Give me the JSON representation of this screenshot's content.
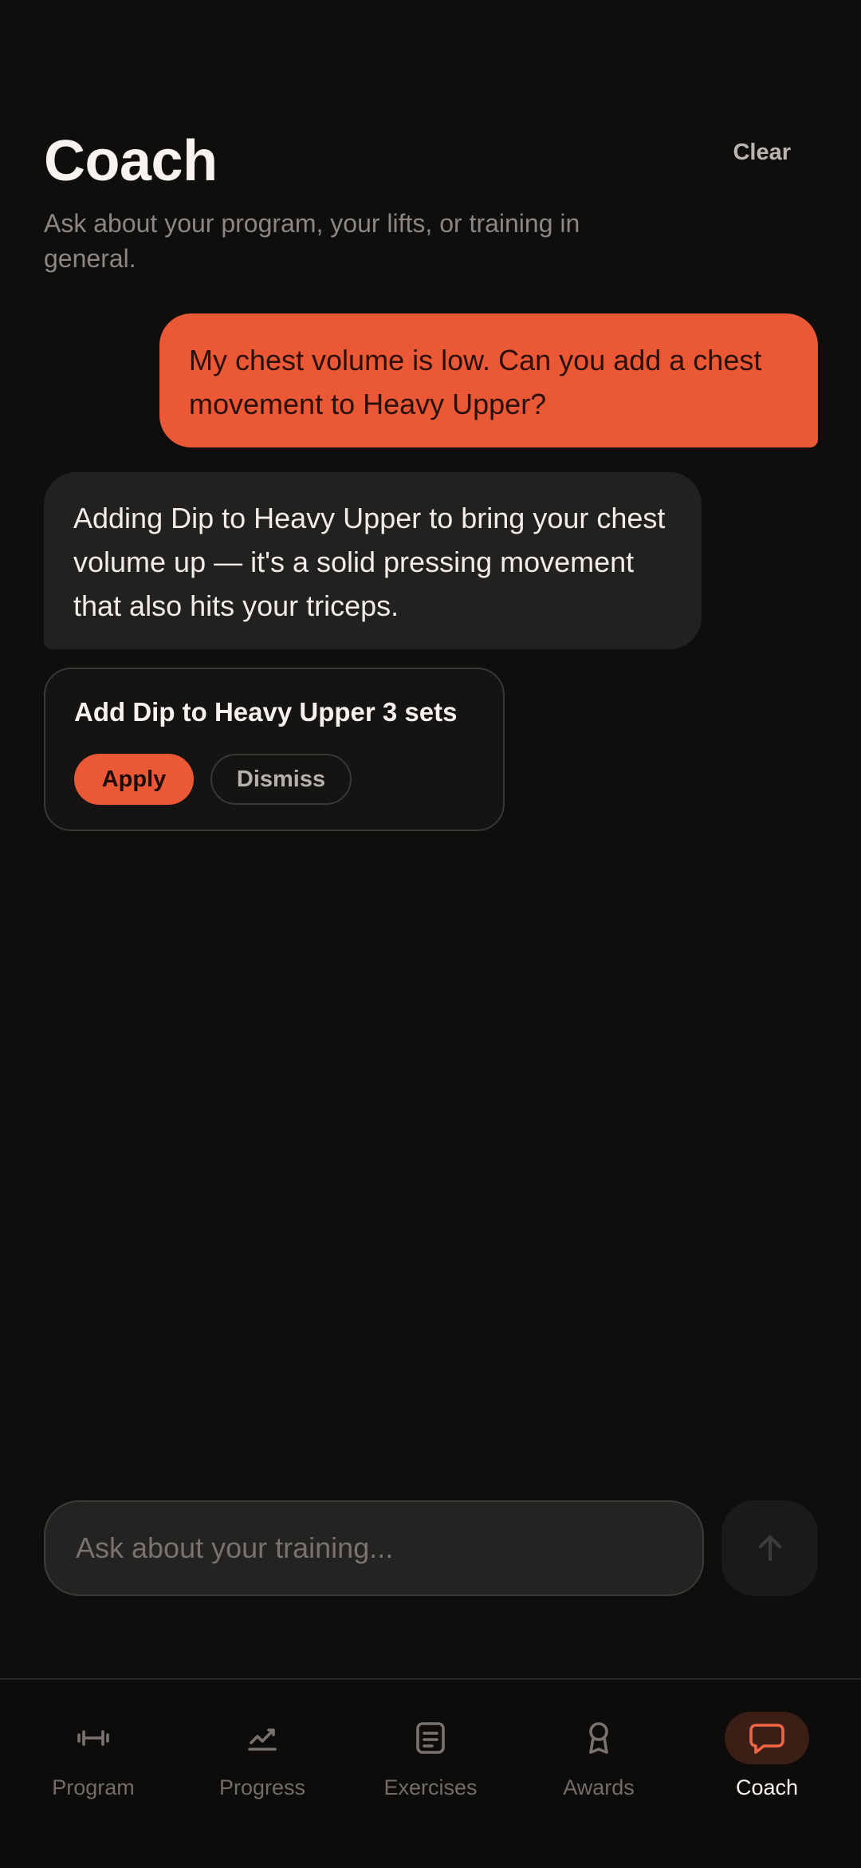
{
  "header": {
    "title": "Coach",
    "subtitle": "Ask about your program, your lifts, or training in general.",
    "clear_label": "Clear"
  },
  "conversation": {
    "user_message": "My chest volume is low. Can you add a chest movement to Heavy Upper?",
    "assistant_message": "Adding Dip to Heavy Upper to bring your chest volume up — it's a solid pressing movement that also hits your triceps.",
    "action_card": {
      "title": "Add Dip to Heavy Upper 3 sets",
      "apply_label": "Apply",
      "dismiss_label": "Dismiss"
    }
  },
  "composer": {
    "placeholder": "Ask about your training...",
    "send_icon": "arrow-up-icon"
  },
  "nav": {
    "items": [
      {
        "label": "Program",
        "icon": "dumbbell-icon"
      },
      {
        "label": "Progress",
        "icon": "trend-line-icon"
      },
      {
        "label": "Exercises",
        "icon": "document-list-icon"
      },
      {
        "label": "Awards",
        "icon": "award-ribbon-icon"
      },
      {
        "label": "Coach",
        "icon": "chat-bubble-icon"
      }
    ],
    "active": "Coach"
  },
  "colors": {
    "background": "#0f0e0d",
    "accent": "#ea5836",
    "assistant_bubble": "#222120"
  }
}
